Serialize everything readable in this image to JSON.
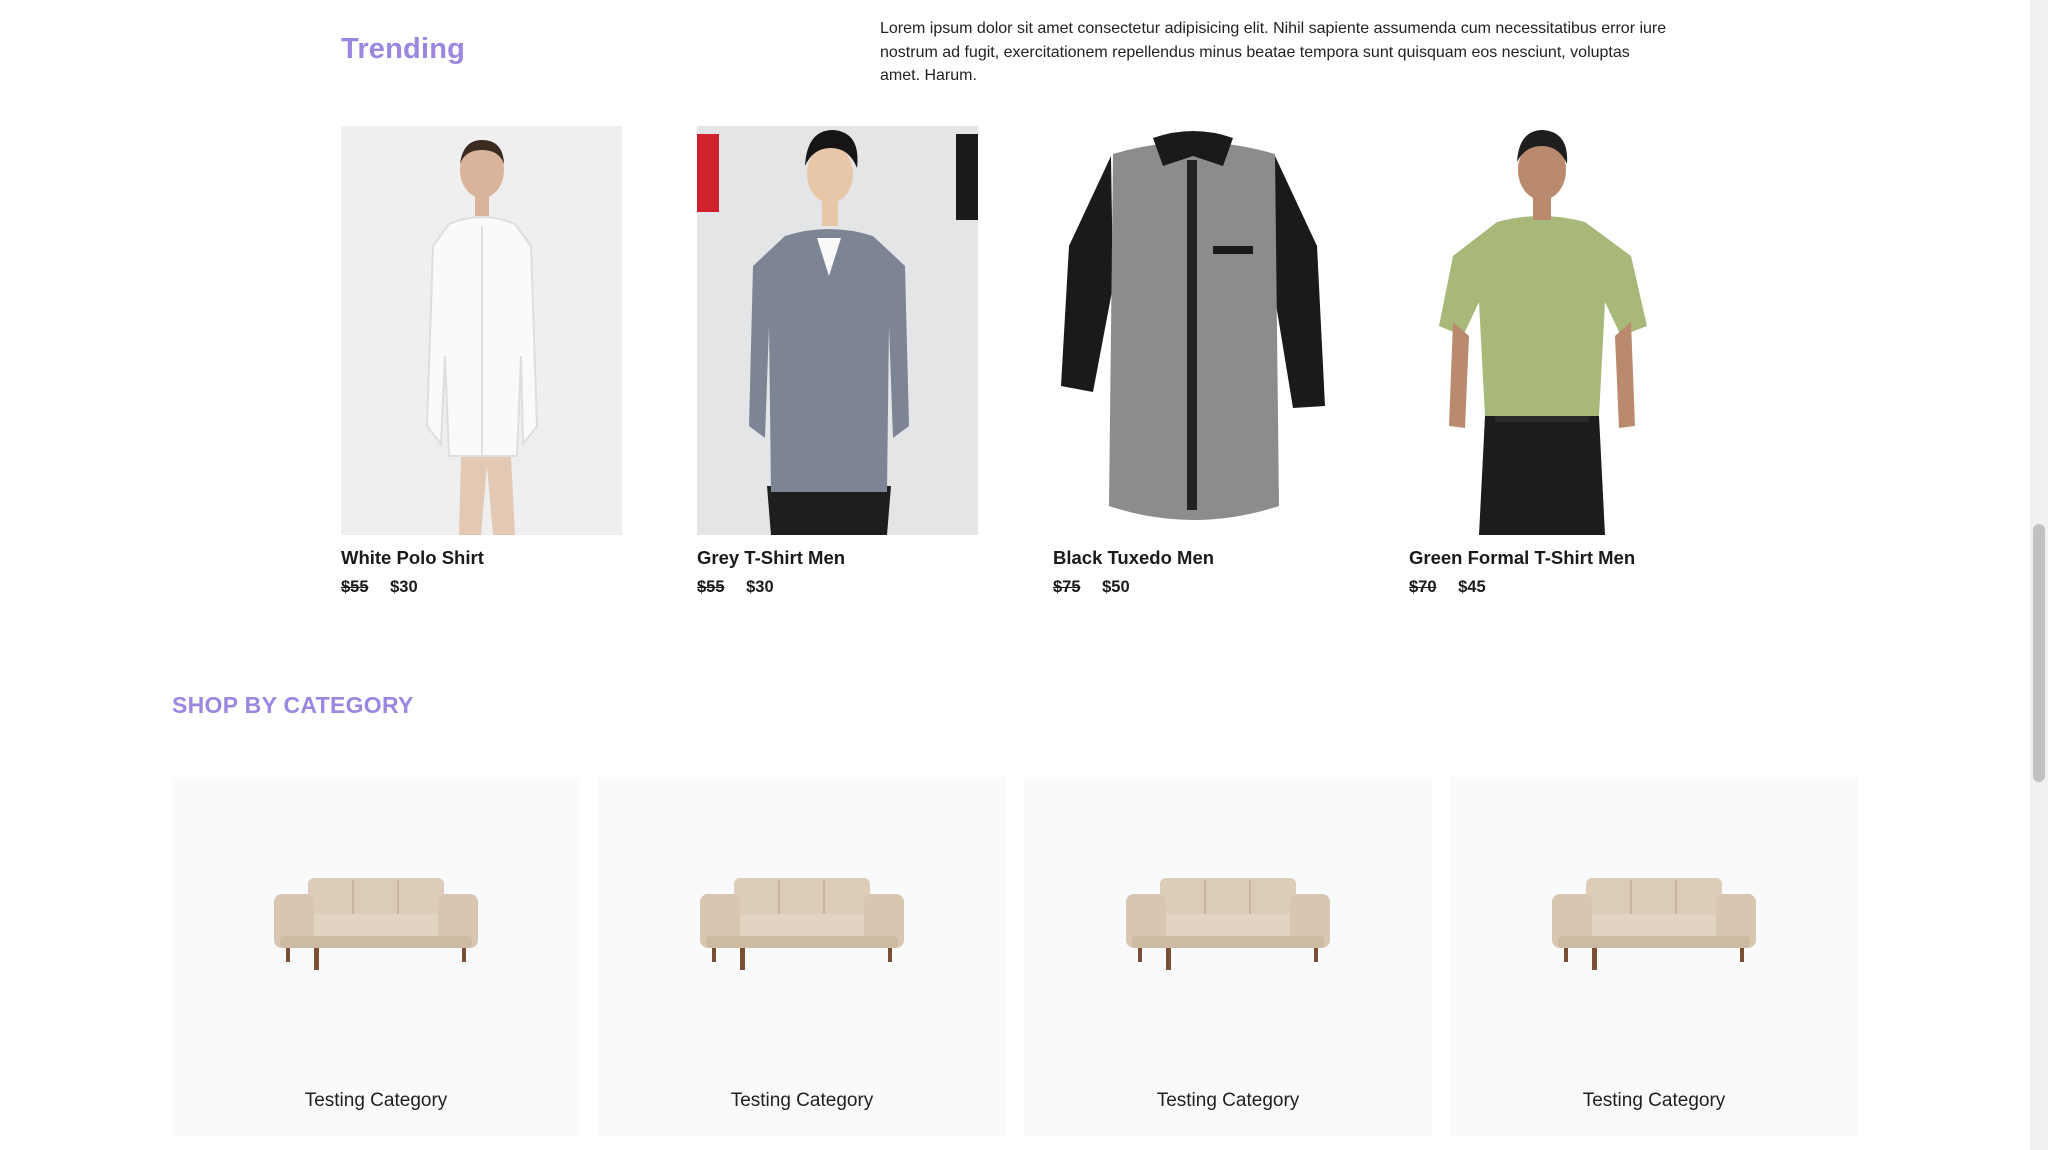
{
  "trending": {
    "title": "Trending",
    "description": "Lorem ipsum dolor sit amet consectetur adipisicing elit. Nihil sapiente assumenda cum necessitatibus error iure nostrum ad fugit, exercitationem repellendus minus beatae tempora sunt quisquam eos nesciunt, voluptas amet. Harum.",
    "products": [
      {
        "name": "White Polo Shirt",
        "old_price": "$55",
        "price": "$30"
      },
      {
        "name": "Grey T-Shirt Men",
        "old_price": "$55",
        "price": "$30"
      },
      {
        "name": "Black Tuxedo Men",
        "old_price": "$75",
        "price": "$50"
      },
      {
        "name": "Green Formal T-Shirt Men",
        "old_price": "$70",
        "price": "$45"
      }
    ]
  },
  "categories": {
    "title": "SHOP BY CATEGORY",
    "items": [
      {
        "label": "Testing Category"
      },
      {
        "label": "Testing Category"
      },
      {
        "label": "Testing Category"
      },
      {
        "label": "Testing Category"
      }
    ]
  },
  "colors": {
    "accent": "#9b86e0",
    "card_background": "#f9fafc"
  }
}
